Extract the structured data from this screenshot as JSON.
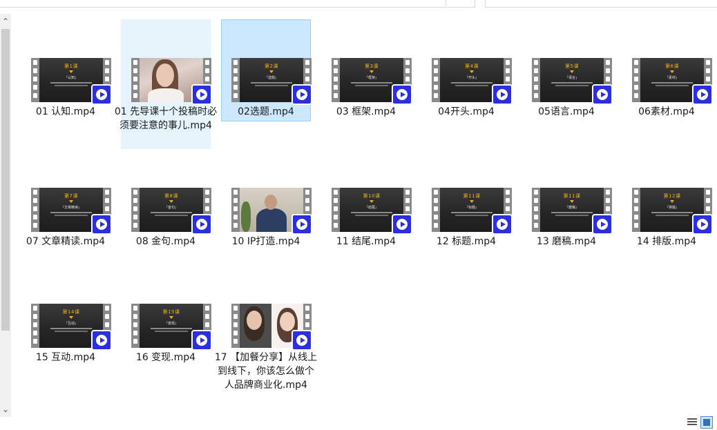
{
  "files": [
    {
      "name": "01 认知.mp4",
      "lesson": "第1课",
      "sub": "『认知』",
      "kind": "slide",
      "state": "normal"
    },
    {
      "name": "01 先导课十个投稿时必须要注意的事儿.mp4",
      "lesson": "",
      "sub": "",
      "kind": "photo-woman",
      "state": "hover"
    },
    {
      "name": "02选题.mp4",
      "lesson": "第2课",
      "sub": "『选题』",
      "kind": "slide",
      "state": "selected"
    },
    {
      "name": "03 框架.mp4",
      "lesson": "第3课",
      "sub": "『框架』",
      "kind": "slide",
      "state": "normal"
    },
    {
      "name": "04开头.mp4",
      "lesson": "第4课",
      "sub": "『开头』",
      "kind": "slide",
      "state": "normal"
    },
    {
      "name": "05语言.mp4",
      "lesson": "第5课",
      "sub": "『语言』",
      "kind": "slide",
      "state": "normal"
    },
    {
      "name": "06素材.mp4",
      "lesson": "第6课",
      "sub": "『素材』",
      "kind": "slide",
      "state": "normal"
    },
    {
      "name": "07 文章精读.mp4",
      "lesson": "第7课",
      "sub": "『文章精读』",
      "kind": "slide",
      "state": "normal"
    },
    {
      "name": "08 金句.mp4",
      "lesson": "第8课",
      "sub": "『金句』",
      "kind": "slide",
      "state": "normal"
    },
    {
      "name": "10 IP打造.mp4",
      "lesson": "",
      "sub": "",
      "kind": "photo-man",
      "state": "normal"
    },
    {
      "name": "11 结尾.mp4",
      "lesson": "第10课",
      "sub": "『结尾』",
      "kind": "slide",
      "state": "normal"
    },
    {
      "name": "12 标题.mp4",
      "lesson": "第11课",
      "sub": "『标题』",
      "kind": "slide",
      "state": "normal"
    },
    {
      "name": "13 磨稿.mp4",
      "lesson": "第11课",
      "sub": "『磨稿』",
      "kind": "slide",
      "state": "normal"
    },
    {
      "name": "14 排版.mp4",
      "lesson": "第12课",
      "sub": "『排版』",
      "kind": "slide",
      "state": "normal"
    },
    {
      "name": "15 互动.mp4",
      "lesson": "第14课",
      "sub": "『互动』",
      "kind": "slide",
      "state": "normal"
    },
    {
      "name": "16 变现.mp4",
      "lesson": "第15课",
      "sub": "『变现』",
      "kind": "slide",
      "state": "normal"
    },
    {
      "name": "17 【加餐分享】从线上到线下，你该怎么做个人品牌商业化.mp4",
      "lesson": "",
      "sub": "",
      "kind": "photo-two",
      "state": "normal"
    }
  ],
  "icons": {
    "scroll_up": "chevron-up-icon",
    "scroll_down": "chevron-down-icon",
    "badge": "video-player-app-icon",
    "details_view": "details-view-icon",
    "large_icons_view": "large-icons-view-icon"
  },
  "colors": {
    "selected_bg": "#cce8ff",
    "hover_bg": "#e5f3fb",
    "badge": "#2b2fe0",
    "lesson_text": "#f2b01e"
  }
}
